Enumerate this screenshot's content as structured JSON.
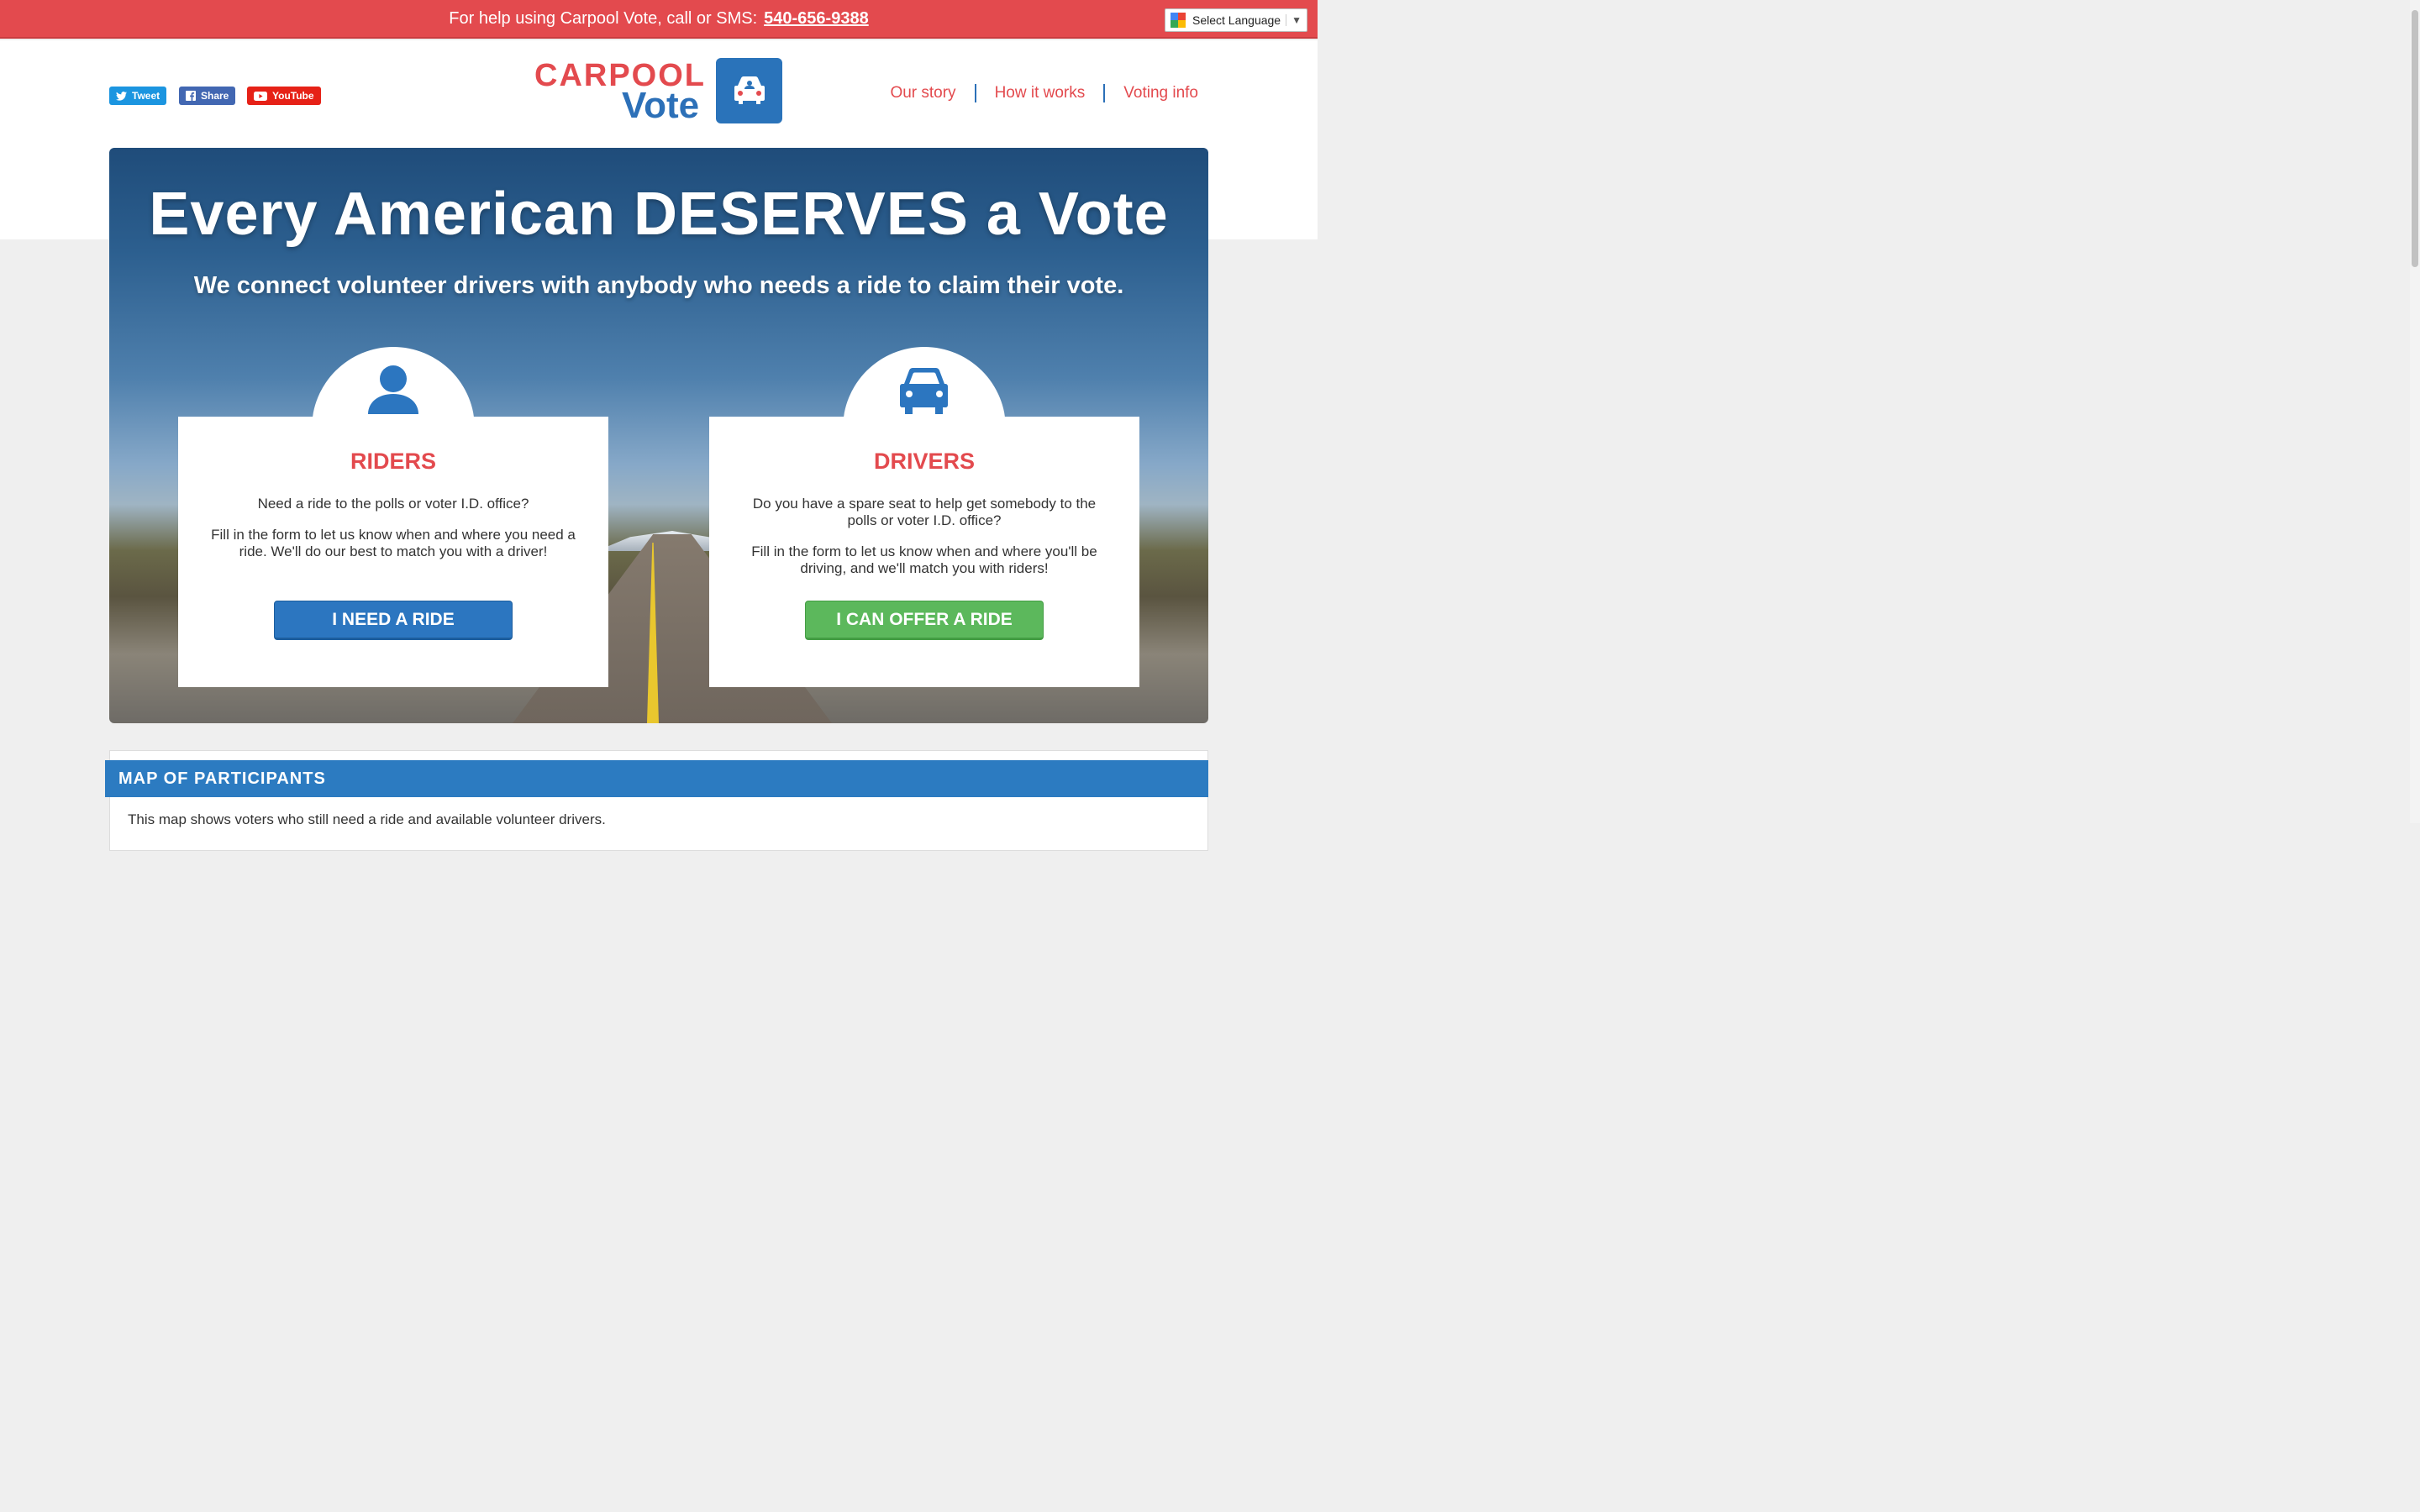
{
  "helpbar": {
    "text": "For help using Carpool Vote, call or SMS:",
    "phone": "540-656-9388"
  },
  "language": {
    "label": "Select Language",
    "caret": "▼"
  },
  "social": {
    "tweet": "Tweet",
    "share": "Share",
    "youtube": "YouTube"
  },
  "logo": {
    "word1": "CARPOOL",
    "word2": "Vote"
  },
  "nav": {
    "items": [
      "Our story",
      "How it works",
      "Voting info"
    ]
  },
  "hero": {
    "title": "Every American DESERVES a Vote",
    "subtitle": "We connect volunteer drivers with anybody who needs a ride to claim their vote."
  },
  "riders": {
    "heading": "RIDERS",
    "line1": "Need a ride to the polls or voter I.D. office?",
    "line2": "Fill in the form to let us know when and where you need a ride. We'll do our best to match you with a driver!",
    "button": "I NEED A RIDE"
  },
  "drivers": {
    "heading": "DRIVERS",
    "line1": "Do you have a spare seat to help get somebody to the polls or voter I.D. office?",
    "line2": "Fill in the form to let us know when and where you'll be driving, and we'll match you with riders!",
    "button": "I CAN OFFER A RIDE"
  },
  "map": {
    "heading": "MAP OF PARTICIPANTS",
    "text": "This map shows voters who still need a ride and available volunteer drivers."
  },
  "colors": {
    "brand_red": "#e34a4e",
    "brand_blue": "#2c70b8",
    "green": "#5cb85c"
  }
}
